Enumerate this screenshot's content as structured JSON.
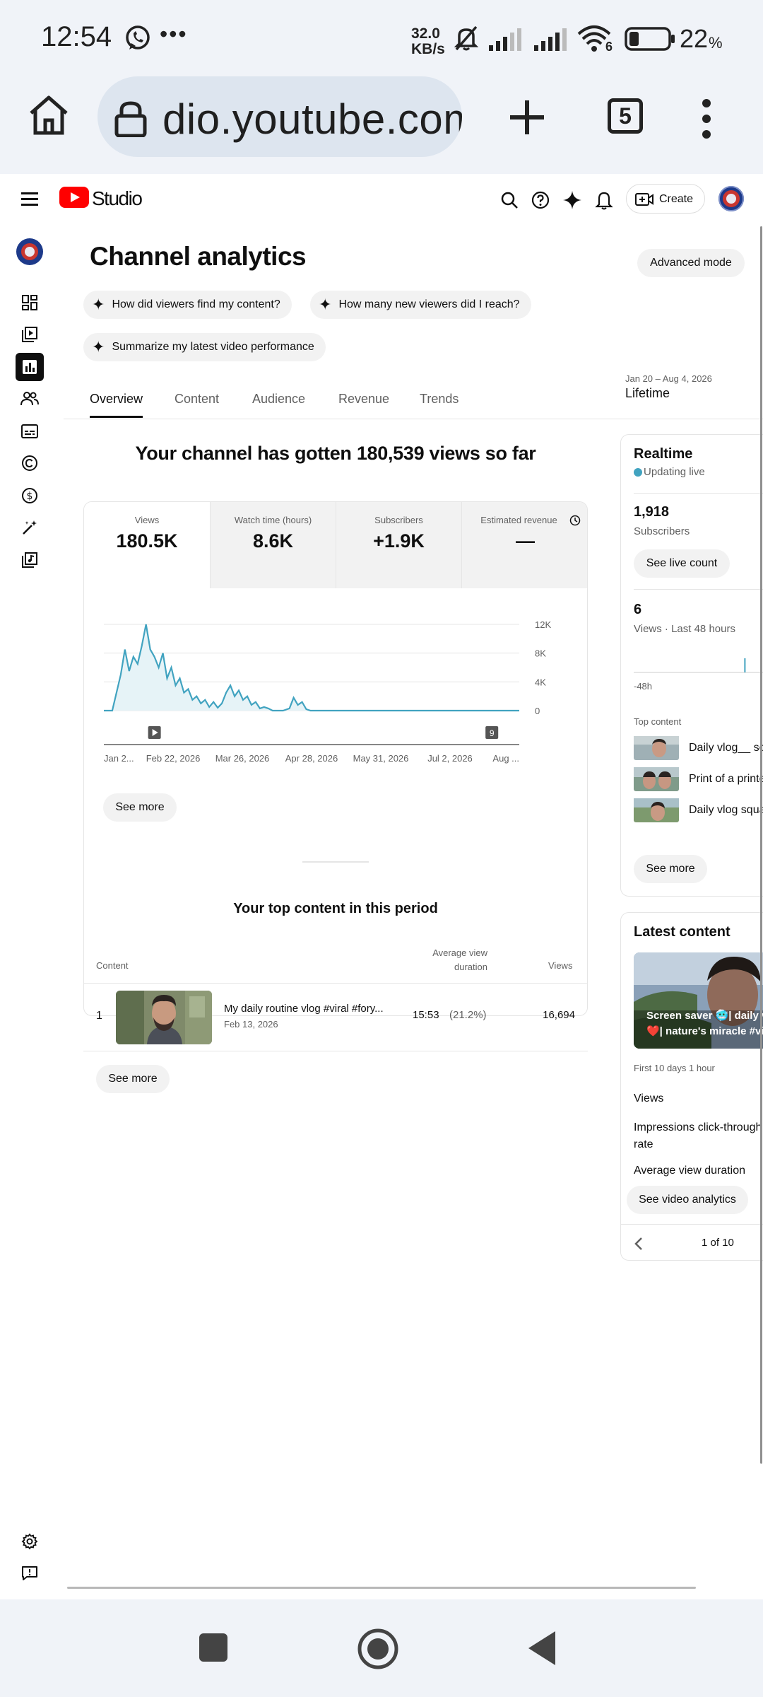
{
  "status": {
    "time": "12:54",
    "net_speed_value": "32.0",
    "net_speed_unit": "KB/s",
    "wifi_badge": "6",
    "battery": "22",
    "battery_unit": "%"
  },
  "browser": {
    "url": "dio.youtube.com",
    "tab_count": "5"
  },
  "header": {
    "brand": "Studio",
    "create_label": "Create"
  },
  "page": {
    "title": "Channel analytics",
    "advanced_mode": "Advanced mode",
    "prompts": [
      "How did viewers find my content?",
      "How many new viewers did I reach?",
      "Summarize my latest video performance"
    ],
    "tabs": [
      "Overview",
      "Content",
      "Audience",
      "Revenue",
      "Trends"
    ],
    "date_range": "Jan 20 – Aug 4, 2026",
    "date_preset": "Lifetime"
  },
  "summary": {
    "headline": "Your channel has gotten 180,539 views so far",
    "metrics": [
      {
        "label": "Views",
        "value": "180.5K"
      },
      {
        "label": "Watch time (hours)",
        "value": "8.6K"
      },
      {
        "label": "Subscribers",
        "value": "+1.9K"
      },
      {
        "label": "Estimated revenue",
        "value": "—"
      }
    ],
    "see_more": "See more"
  },
  "chart_data": {
    "type": "area",
    "title": "",
    "xlabel": "",
    "ylabel": "",
    "y_ticks": [
      "12K",
      "8K",
      "4K",
      "0"
    ],
    "ylim": [
      0,
      12000
    ],
    "x_ticks": [
      "Jan 2...",
      "Feb 22, 2026",
      "Mar 26, 2026",
      "Apr 28, 2026",
      "May 31, 2026",
      "Jul 2, 2026",
      "Aug ..."
    ],
    "x_index_range": [
      0,
      197
    ],
    "series": [
      {
        "color": "#41a3c0",
        "points": [
          [
            0,
            0
          ],
          [
            4,
            0
          ],
          [
            8,
            5000
          ],
          [
            10,
            8500
          ],
          [
            12,
            5500
          ],
          [
            14,
            7500
          ],
          [
            16,
            6500
          ],
          [
            18,
            9000
          ],
          [
            20,
            12000
          ],
          [
            22,
            8500
          ],
          [
            24,
            7500
          ],
          [
            26,
            6000
          ],
          [
            28,
            8000
          ],
          [
            30,
            4500
          ],
          [
            32,
            6000
          ],
          [
            34,
            3500
          ],
          [
            36,
            4500
          ],
          [
            38,
            2500
          ],
          [
            40,
            3000
          ],
          [
            42,
            1500
          ],
          [
            44,
            2000
          ],
          [
            46,
            1000
          ],
          [
            48,
            1500
          ],
          [
            50,
            500
          ],
          [
            52,
            1200
          ],
          [
            54,
            400
          ],
          [
            56,
            1000
          ],
          [
            58,
            2500
          ],
          [
            60,
            3500
          ],
          [
            62,
            2000
          ],
          [
            64,
            2800
          ],
          [
            66,
            1500
          ],
          [
            68,
            2000
          ],
          [
            70,
            800
          ],
          [
            72,
            1200
          ],
          [
            74,
            300
          ],
          [
            76,
            500
          ],
          [
            78,
            300
          ],
          [
            80,
            0
          ],
          [
            85,
            0
          ],
          [
            88,
            300
          ],
          [
            90,
            1800
          ],
          [
            92,
            800
          ],
          [
            94,
            1200
          ],
          [
            96,
            200
          ],
          [
            98,
            0
          ],
          [
            197,
            0
          ]
        ]
      }
    ],
    "markers": [
      {
        "x_index": 24,
        "type": "play-icon"
      },
      {
        "x_index": 184,
        "label": "9"
      }
    ],
    "grid": true
  },
  "top_content": {
    "heading": "Your top content in this period",
    "col_content": "Content",
    "col_avd": "Average view duration",
    "col_views": "Views",
    "rows": [
      {
        "rank": "1",
        "title": "My daily routine vlog #viral #fory...",
        "date": "Feb 13, 2026",
        "avd": "15:53",
        "avd_pct": "(21.2%)",
        "views": "16,694"
      }
    ],
    "see_more": "See more"
  },
  "realtime": {
    "title": "Realtime",
    "live": "Updating live",
    "subs_value": "1,918",
    "subs_label": "Subscribers",
    "see_live": "See live count",
    "views_value": "6",
    "views_label": "Views · Last 48 hours",
    "axis_label": "-48h",
    "bars": [
      0,
      0,
      0,
      0,
      0,
      0,
      0,
      0,
      0,
      0,
      0,
      0,
      0,
      0,
      0,
      0,
      0,
      0,
      0,
      0,
      0,
      0,
      0,
      0,
      0,
      0,
      0,
      0,
      0,
      0,
      0,
      0,
      0,
      0,
      0,
      0,
      0,
      0,
      0,
      0,
      0,
      0,
      0,
      0,
      0,
      0,
      0,
      0,
      0,
      0,
      0,
      0,
      0,
      0,
      0,
      0,
      0,
      0,
      0,
      0,
      0,
      0,
      0,
      0,
      0,
      0,
      0,
      0,
      0,
      0,
      0,
      0,
      3,
      0,
      0,
      0,
      0,
      0,
      0,
      0,
      0,
      0,
      0,
      0,
      0,
      0,
      0,
      0,
      0,
      0,
      0,
      0,
      3
    ],
    "top_content_label": "Top content",
    "items": [
      "Daily vlog__ scr",
      "Print of a printe",
      "Daily vlog squa"
    ],
    "see_more": "See more"
  },
  "latest": {
    "title": "Latest content",
    "thumb_caption_1": "Screen saver 🥶| daily v",
    "thumb_caption_2": "❤️| nature's miracle #vi",
    "period": "First 10 days 1 hour",
    "rows": [
      "Views",
      "Impressions click-through rate",
      "Average view duration"
    ],
    "see_analytics": "See video analytics",
    "pager": "1 of 10"
  }
}
